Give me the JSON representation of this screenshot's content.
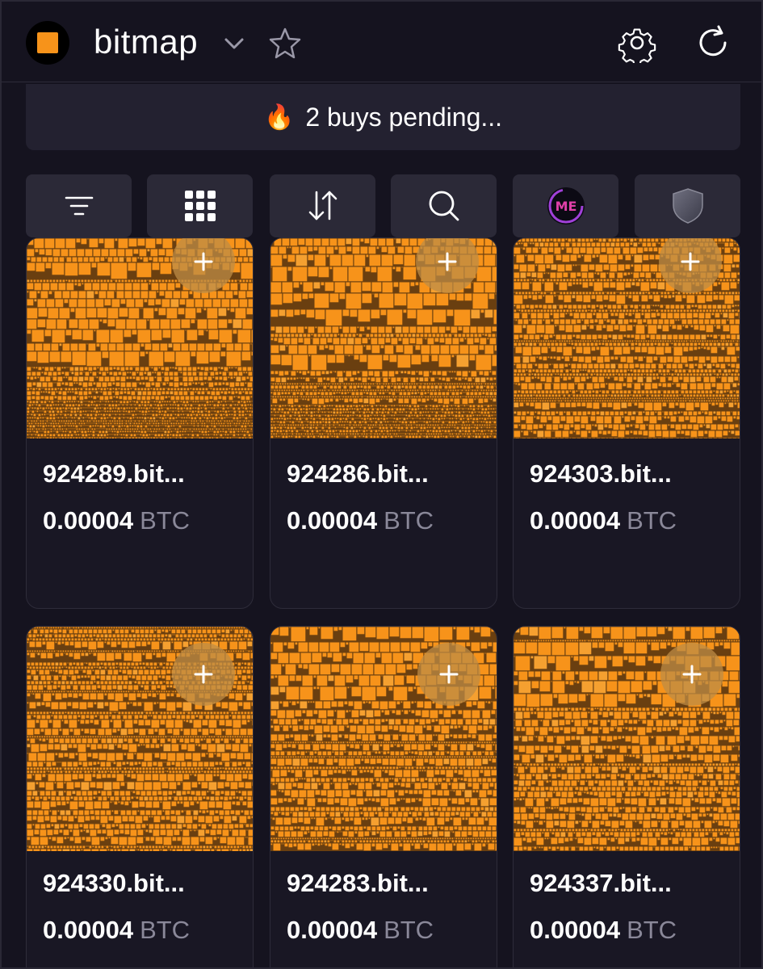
{
  "header": {
    "title": "bitmap",
    "logo_color": "#f7931a",
    "icons": [
      "chevron-down-icon",
      "star-icon",
      "gear-icon",
      "refresh-icon"
    ]
  },
  "banner": {
    "icon": "fire-icon",
    "emoji": "🔥",
    "text": "2 buys pending..."
  },
  "toolbar": {
    "buttons": [
      {
        "name": "filter-button",
        "icon": "filter-icon"
      },
      {
        "name": "grid-view-button",
        "icon": "grid-icon"
      },
      {
        "name": "sort-button",
        "icon": "sort-arrows-icon"
      },
      {
        "name": "search-button",
        "icon": "search-icon"
      },
      {
        "name": "magic-eden-button",
        "icon": "magic-eden-icon"
      },
      {
        "name": "shield-button",
        "icon": "shield-icon"
      }
    ]
  },
  "listings": [
    {
      "name": "924289.bit...",
      "price": "0.00004",
      "unit": "BTC"
    },
    {
      "name": "924286.bit...",
      "price": "0.00004",
      "unit": "BTC"
    },
    {
      "name": "924303.bit...",
      "price": "0.00004",
      "unit": "BTC"
    },
    {
      "name": "924330.bit...",
      "price": "0.00004",
      "unit": "BTC"
    },
    {
      "name": "924283.bit...",
      "price": "0.00004",
      "unit": "BTC"
    },
    {
      "name": "924337.bit...",
      "price": "0.00004",
      "unit": "BTC"
    }
  ],
  "colors": {
    "background": "#15131f",
    "card": "#191724",
    "button": "#2b2937",
    "accent_orange": "#f7931a",
    "muted_text": "#8a8899"
  }
}
